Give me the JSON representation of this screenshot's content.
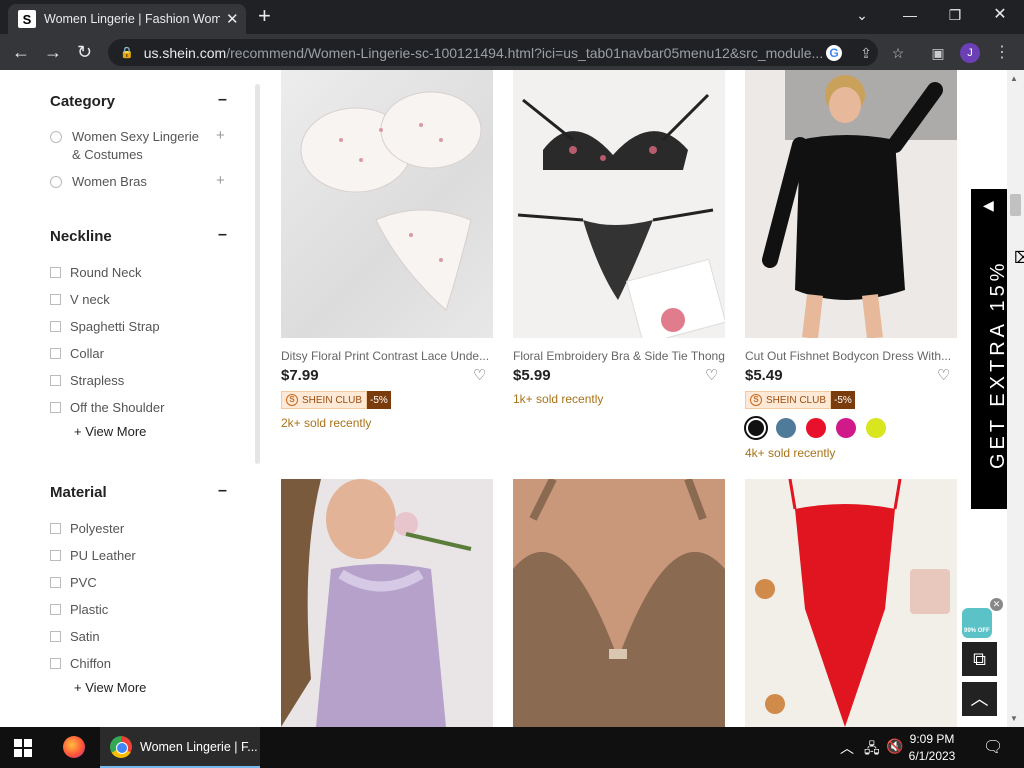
{
  "browser": {
    "tab_title": "Women Lingerie | Fashion Wome",
    "url_domain": "us.shein.com",
    "url_path": "/recommend/Women-Lingerie-sc-100121494.html?ici=us_tab01navbar05menu12&src_module...",
    "profile_initial": "J"
  },
  "sidebar": {
    "category": {
      "title": "Category",
      "items": [
        "Women Sexy Lingerie & Costumes",
        "Women Bras"
      ]
    },
    "neckline": {
      "title": "Neckline",
      "items": [
        "Round Neck",
        "V neck",
        "Spaghetti Strap",
        "Collar",
        "Strapless",
        "Off the Shoulder"
      ],
      "view_more": "+ View More"
    },
    "material": {
      "title": "Material",
      "items": [
        "Polyester",
        "PU Leather",
        "PVC",
        "Plastic",
        "Satin",
        "Chiffon"
      ],
      "view_more": "+ View More"
    }
  },
  "products": [
    {
      "name": "Ditsy Floral Print Contrast Lace Unde...",
      "price": "$7.99",
      "club": "SHEIN CLUB",
      "discount": "-5%",
      "sold": "2k+ sold recently"
    },
    {
      "name": "Floral Embroidery Bra & Side Tie Thong",
      "price": "$5.99",
      "sold": "1k+ sold recently"
    },
    {
      "name": "Cut Out Fishnet Bodycon Dress With...",
      "price": "$5.49",
      "club": "SHEIN CLUB",
      "discount": "-5%",
      "sold": "4k+ sold recently",
      "swatches": [
        "#111111",
        "#4f7a99",
        "#e8102a",
        "#d11a8a",
        "#d7e61e"
      ]
    }
  ],
  "promo": {
    "side_banner": "GET EXTRA 15%",
    "coupon_badge": "99% OFF"
  },
  "taskbar": {
    "app_label": "Women Lingerie | F...",
    "time": "9:09 PM",
    "date": "6/1/2023"
  }
}
